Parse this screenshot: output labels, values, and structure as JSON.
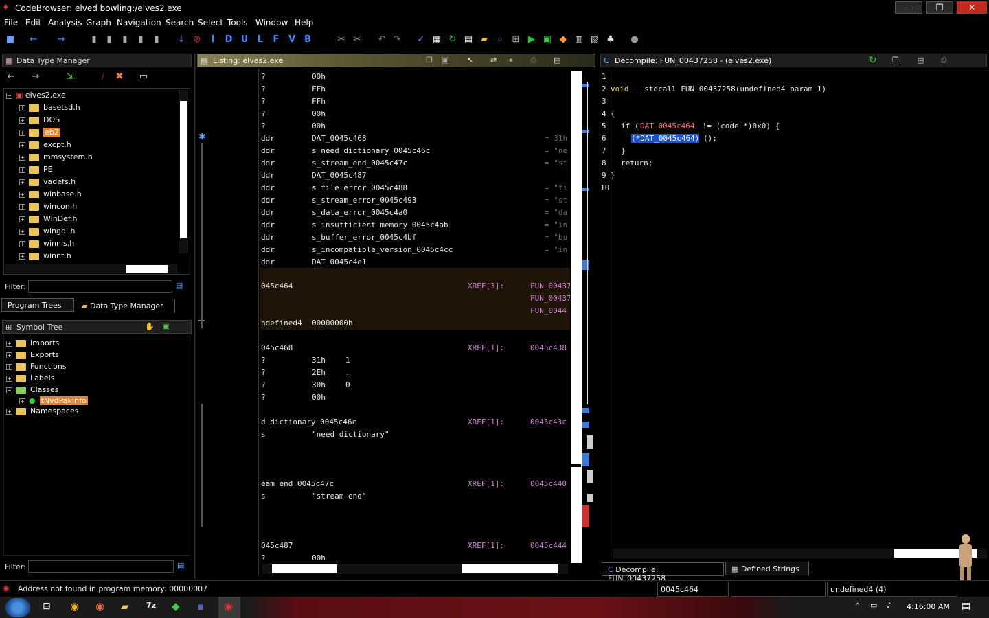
{
  "window": {
    "title": "CodeBrowser: elved bowling:/elves2.exe",
    "minimize": "—",
    "restore": "❐",
    "close": "✕"
  },
  "menu": [
    "File",
    "Edit",
    "Analysis",
    "Graph",
    "Navigation",
    "Search",
    "Select",
    "Tools",
    "Window",
    "Help"
  ],
  "toolbar_letters": [
    "I",
    "D",
    "U",
    "L",
    "F",
    "V",
    "B"
  ],
  "dtm": {
    "title": "Data Type Manager",
    "root": "elves2.exe",
    "items": [
      "basetsd.h",
      "DOS",
      "eb2",
      "excpt.h",
      "mmsystem.h",
      "PE",
      "vadefs.h",
      "winbase.h",
      "wincon.h",
      "WinDef.h",
      "wingdi.h",
      "winnls.h",
      "winnt.h"
    ],
    "filter_label": "Filter:",
    "tab_program_trees": "Program Trees",
    "tab_dtm": "Data Type Manager"
  },
  "symbol_tree": {
    "title": "Symbol Tree",
    "items": [
      "Imports",
      "Exports",
      "Functions",
      "Labels",
      "Classes",
      "Namespaces"
    ],
    "class_child": "tNvdPakInfo",
    "filter_label": "Filter:"
  },
  "listing": {
    "title": "Listing:  elves2.exe",
    "rows": [
      {
        "a": "?",
        "b": "00h",
        "c": "",
        "d": ""
      },
      {
        "a": "?",
        "b": "FFh",
        "c": "",
        "d": ""
      },
      {
        "a": "?",
        "b": "FFh",
        "c": "",
        "d": ""
      },
      {
        "a": "?",
        "b": "00h",
        "c": "",
        "d": ""
      },
      {
        "a": "?",
        "b": "00h",
        "c": "",
        "d": ""
      },
      {
        "a": "ddr",
        "b": "DAT_0045c468",
        "c": "",
        "d": "= 31h"
      },
      {
        "a": "ddr",
        "b": "s_need_dictionary_0045c46c",
        "c": "",
        "d": "= \"ne"
      },
      {
        "a": "ddr",
        "b": "s_stream_end_0045c47c",
        "c": "",
        "d": "= \"st"
      },
      {
        "a": "ddr",
        "b": "DAT_0045c487",
        "c": "",
        "d": ""
      },
      {
        "a": "ddr",
        "b": "s_file_error_0045c488",
        "c": "",
        "d": "= \"fi"
      },
      {
        "a": "ddr",
        "b": "s_stream_error_0045c493",
        "c": "",
        "d": "= \"st"
      },
      {
        "a": "ddr",
        "b": "s_data_error_0045c4a0",
        "c": "",
        "d": "= \"da"
      },
      {
        "a": "ddr",
        "b": "s_insufficient_memory_0045c4ab",
        "c": "",
        "d": "= \"in"
      },
      {
        "a": "ddr",
        "b": "s_buffer_error_0045c4bf",
        "c": "",
        "d": "= \"bu"
      },
      {
        "a": "ddr",
        "b": "s_incompatible_version_0045c4cc",
        "c": "",
        "d": "= \"in"
      },
      {
        "a": "ddr",
        "b": "DAT_0045c4e1",
        "c": "",
        "d": ""
      }
    ],
    "block1_label": "045c464",
    "block1_xref": "XREF[3]:",
    "block1_refs": [
      "FUN_00437",
      "FUN_00437",
      "FUN_0044"
    ],
    "block1_type": "ndefined4",
    "block1_val": "00000000h",
    "block2_label": "045c468",
    "block2_xref": "XREF[1]:",
    "block2_ref": "0045c438",
    "block2_rows": [
      [
        "?",
        "31h",
        "1"
      ],
      [
        "?",
        "2Eh",
        "."
      ],
      [
        "?",
        "30h",
        "0"
      ],
      [
        "?",
        "00h",
        ""
      ]
    ],
    "block3_label": "d_dictionary_0045c46c",
    "block3_xref": "XREF[1]:",
    "block3_ref": "0045c43c",
    "block3_a": "s",
    "block3_str": "\"need dictionary\"",
    "block4_label": "eam_end_0045c47c",
    "block4_xref": "XREF[1]:",
    "block4_ref": "0045c440",
    "block4_a": "s",
    "block4_str": "\"stream end\"",
    "block5_label": "045c487",
    "block5_xref": "XREF[1]:",
    "block5_ref": "0045c444",
    "block5_a": "?",
    "block5_val": "00h"
  },
  "decompile": {
    "title": "Decompile: FUN_00437258 -  (elves2.exe)",
    "line_numbers": [
      "1",
      "2",
      "3",
      "4",
      "5",
      "6",
      "7",
      "8",
      "9",
      "10"
    ],
    "l2_void": "void",
    "l2_sig": "__stdcall FUN_00437258(undefined4 param_1)",
    "l4": "{",
    "l5_if": "if (",
    "l5_dat": "DAT_0045c464",
    "l5_rest": " != (code *)0x0) {",
    "l6_sel": "(*DAT_0045c464)",
    "l6_rest": "();",
    "l7": "}",
    "l8": "return;",
    "l9": "}",
    "tab_decompile": "Decompile: FUN_00437258",
    "tab_strings": "Defined Strings"
  },
  "status": {
    "message": "Address not found in program memory: 00000007",
    "address": "0045c464",
    "datatype": "undefined4 (4)"
  },
  "taskbar": {
    "time": "4:16:00 AM"
  }
}
